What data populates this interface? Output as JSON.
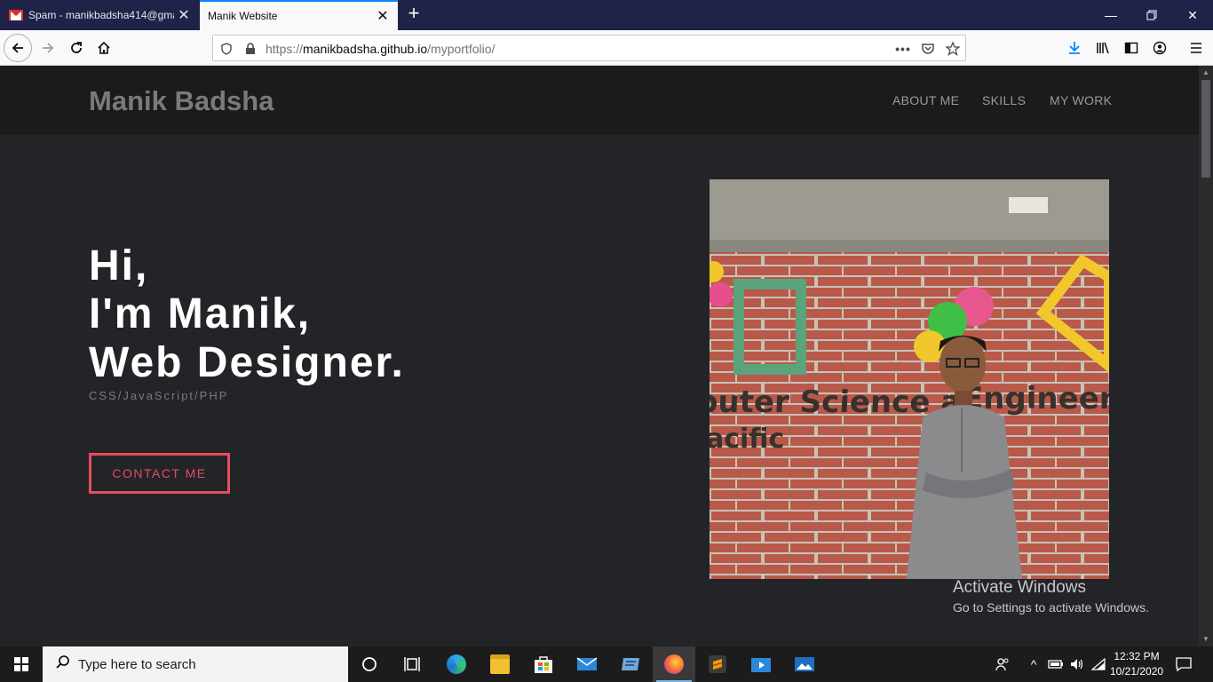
{
  "browser": {
    "tabs": [
      {
        "title": "Spam - manikbadsha414@gma",
        "icon": "gmail-icon"
      },
      {
        "title": "Manik Website",
        "icon": ""
      }
    ],
    "url_prefix": "https://",
    "url_host": "manikbadsha.github.io",
    "url_path": "/myportfolio/"
  },
  "site": {
    "brand": "Manik Badsha",
    "nav": [
      "ABOUT ME",
      "SKILLS",
      "MY WORK"
    ],
    "hero": [
      "Hi,",
      "I'm Manik,",
      "Web Designer."
    ],
    "skills": "CSS/JavaScript/PHP",
    "cta": "CONTACT ME",
    "photo_caption_visible": "puter Science a   Engineer",
    "photo_caption2_visible": "acific"
  },
  "watermark": {
    "title": "Activate Windows",
    "subtitle": "Go to Settings to activate Windows."
  },
  "taskbar": {
    "search_placeholder": "Type here to search",
    "time": "12:32 PM",
    "date": "10/21/2020"
  },
  "colors": {
    "accent": "#e74c5e",
    "tab_highlight": "#0a84ff",
    "page_bg": "#232427",
    "header_bg": "#1b1b1c"
  }
}
